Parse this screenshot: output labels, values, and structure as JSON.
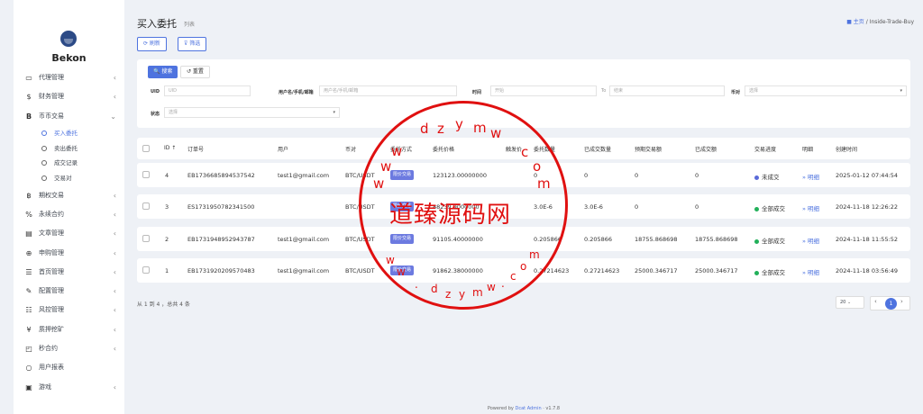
{
  "brand": {
    "name": "Bekon"
  },
  "sidebar": {
    "items": [
      {
        "icon": "▭",
        "label": "代理管理",
        "caret": "‹"
      },
      {
        "icon": "$",
        "label": "财务管理",
        "caret": "‹"
      },
      {
        "icon": "B",
        "label": "币币交易",
        "caret": "⌄"
      },
      {
        "icon": "฿",
        "label": "期权交易",
        "caret": "‹"
      },
      {
        "icon": "%",
        "label": "永续合约",
        "caret": "‹"
      },
      {
        "icon": "▤",
        "label": "文章管理",
        "caret": "‹"
      },
      {
        "icon": "⊕",
        "label": "申购管理",
        "caret": "‹"
      },
      {
        "icon": "☰",
        "label": "首页管理",
        "caret": "‹"
      },
      {
        "icon": "✎",
        "label": "配置管理",
        "caret": "‹"
      },
      {
        "icon": "☷",
        "label": "风控管理",
        "caret": "‹"
      },
      {
        "icon": "¥",
        "label": "质押挖矿",
        "caret": "‹"
      },
      {
        "icon": "◰",
        "label": "秒合约",
        "caret": "‹"
      },
      {
        "icon": "○",
        "label": "用户报表",
        "caret": ""
      },
      {
        "icon": "▣",
        "label": "游戏",
        "caret": "‹"
      }
    ],
    "subitems": [
      "买入委托",
      "卖出委托",
      "成交记录",
      "交易对"
    ]
  },
  "header": {
    "title": "买入委托",
    "subtitle": "列表",
    "breadcrumb_home": "主页",
    "breadcrumb_sep": "/",
    "breadcrumb_current": "Inside-Trade-Buy"
  },
  "toolbar": {
    "refresh": "⟳ 刷新",
    "filter": "⊽ 筛选"
  },
  "filter": {
    "search": "🔍 搜索",
    "reset": "↺ 重置",
    "uid_label": "UID",
    "uid_placeholder": "UID",
    "user_label": "用户名/手机/邮箱",
    "user_placeholder": "用户名/手机/邮箱",
    "time_label": "时间",
    "time_start": "开始",
    "time_to": "To",
    "time_end": "结束",
    "pair_label": "币对",
    "pair_value": "选择",
    "status_label": "状态",
    "status_value": "选择"
  },
  "table": {
    "headers": [
      "ID ↑",
      "订单号",
      "用户",
      "币对",
      "委托方式",
      "委托价格",
      "触发价",
      "委托数量",
      "已成交数量",
      "预期交易额",
      "已成交额",
      "交易进度",
      "明细",
      "创建时间"
    ],
    "rows": [
      {
        "id": "4",
        "order": "EB1736685894537542",
        "user": "test1@gmail.com",
        "pair": "BTC/USDT",
        "method": "限价交易",
        "price": "123123.00000000",
        "trigger": "",
        "qty": "0",
        "filled": "0",
        "expected": "0",
        "done": "0",
        "status": "未成交",
        "status_color": "#5a6ad8",
        "detail": "» 明细",
        "time": "2025-01-12 07:44:54"
      },
      {
        "id": "3",
        "order": "ES1731950782341500",
        "user": "",
        "pair": "BTC/USDT",
        "method": "限价交易",
        "price": "88239.9000000",
        "trigger": "",
        "qty": "3.0E-6",
        "filled": "3.0E-6",
        "expected": "0",
        "done": "0",
        "status": "全部成交",
        "status_color": "#22b05a",
        "detail": "» 明细",
        "time": "2024-11-18 12:26:22"
      },
      {
        "id": "2",
        "order": "EB1731948952943787",
        "user": "test1@gmail.com",
        "pair": "BTC/USDT",
        "method": "限价交易",
        "price": "91105.40000000",
        "trigger": "",
        "qty": "0.205866",
        "filled": "0.205866",
        "expected": "18755.868698",
        "done": "18755.868698",
        "status": "全部成交",
        "status_color": "#22b05a",
        "detail": "» 明细",
        "time": "2024-11-18 11:55:52"
      },
      {
        "id": "1",
        "order": "EB1731920209570483",
        "user": "test1@gmail.com",
        "pair": "BTC/USDT",
        "method": "限价交易",
        "price": "91862.38000000",
        "trigger": "",
        "qty": "0.27214623",
        "filled": "0.27214623",
        "expected": "25000.346717",
        "done": "25000.346717",
        "status": "全部成交",
        "status_color": "#22b05a",
        "detail": "» 明细",
        "time": "2024-11-18 03:56:49"
      }
    ]
  },
  "footer": {
    "info": "从 1 到 4 ，总共 4 条",
    "page_size": "20",
    "page": "1",
    "prev": "‹",
    "next": "›",
    "powered_prefix": "Powered by ",
    "powered_link": "Dcat Admin",
    "powered_suffix": " · v1.7.8"
  },
  "watermark": {
    "text": "道臻源码网",
    "letters": [
      "d",
      "z",
      "y",
      "m",
      "w",
      "c",
      "o",
      "m",
      "w",
      "w",
      "w",
      "w",
      "w",
      ".",
      "d",
      "z",
      "y",
      "m",
      "w",
      ".",
      "c",
      "o",
      "m"
    ]
  }
}
